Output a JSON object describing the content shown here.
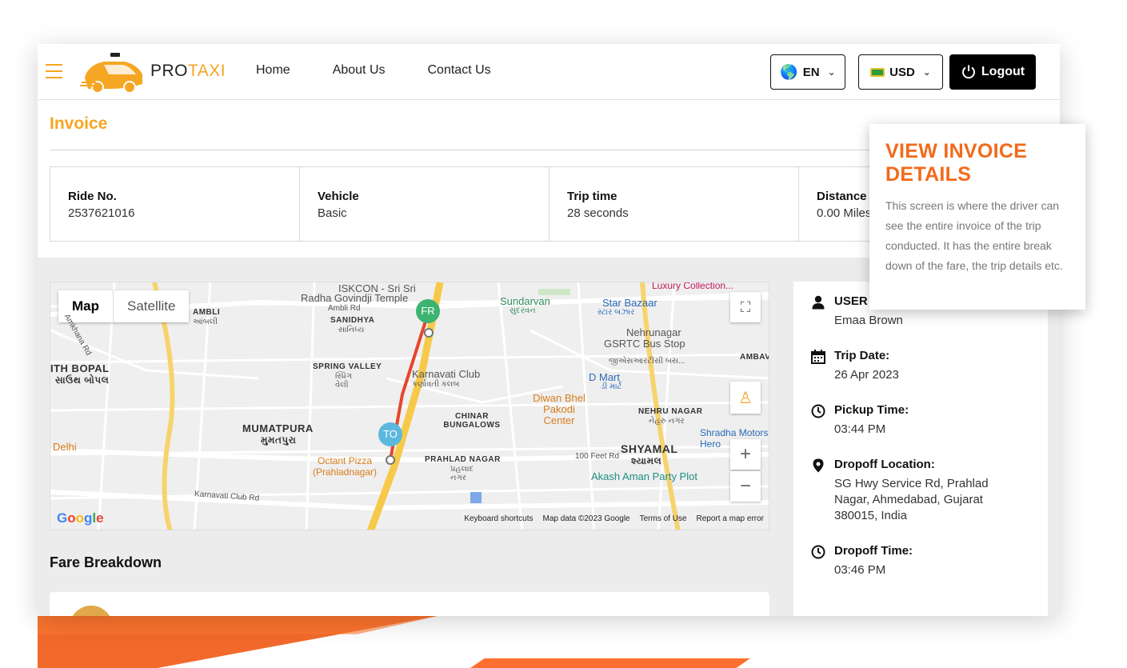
{
  "header": {
    "logo_pro": "PRO",
    "logo_taxi": "TAXI",
    "nav": [
      "Home",
      "About Us",
      "Contact Us"
    ],
    "language": "EN",
    "currency": "USD",
    "logout": "Logout"
  },
  "invoice": {
    "title": "Invoice",
    "stats": [
      {
        "label": "Ride No.",
        "value": "2537621016"
      },
      {
        "label": "Vehicle",
        "value": "Basic"
      },
      {
        "label": "Trip time",
        "value": "28 seconds"
      },
      {
        "label": "Distance",
        "value": "0.00 Miles"
      }
    ]
  },
  "map": {
    "tabs": [
      "Map",
      "Satellite"
    ],
    "pin_from": "FR",
    "pin_to": "TO",
    "labels": {
      "iskcon": "ISKCON - Sri Sri",
      "radha": "Radha Govindji Temple",
      "ambli_rd": "Ambli Rd",
      "ambli": "AMBLI",
      "ambli_gu": "આંબલી",
      "sanidhya": "SANIDHYA",
      "sanidhya_gu": "સાનિધ્ય",
      "sundarvan": "Sundarvan",
      "sundarvan_gu": "સુંદરવન",
      "star_bazaar": "Star Bazaar",
      "star_bazaar_gu": "સ્ટાર બઝાર",
      "luxury": "Luxury Collection...",
      "nehrunagar": "Nehrunagar",
      "gsrtc": "GSRTC Bus Stop",
      "gsrtc_gu": "જીએસઆરટીસી બસ...",
      "ambav": "AMBAV",
      "south_bopal": "ITH BOPAL",
      "south_bopal_gu": "સાઉથ બોપલ",
      "spring_valley": "SPRING VALLEY",
      "spring_valley_gu": "સ્પ્રિંગ વેલી",
      "karnavati": "Karnavati Club",
      "karnavati_gu": "કર્ણાવતી કલબ",
      "dmart": "D Mart",
      "dmart_gu": "ડી માર્ટ",
      "diwan": "Diwan Bhel Pakodi Center",
      "chinar": "CHINAR BUNGALOWS",
      "nehru_nagar": "NEHRU NAGAR",
      "nehru_nagar_gu": "નેહરુ નગર",
      "mumatpura": "MUMATPURA",
      "mumatpura_gu": "મુમતપુરા",
      "shyamal": "SHYAMAL",
      "shyamal_gu": "શ્યામલ",
      "shradha": "Shradha Motors Hero",
      "delhi": "Delhi",
      "octant": "Octant Pizza (Prahladnagar)",
      "prahlad": "PRAHLAD NAGAR",
      "prahlad_gu": "પ્રહલાદ નગર",
      "feet": "100 Feet Rd",
      "akash": "Akash Aman Party Plot",
      "karnavati_rd": "Karnavati Club Rd",
      "khana_rd": "Amkhana Rd"
    },
    "google": "Google",
    "footer": [
      "Keyboard shortcuts",
      "Map data ©2023 Google",
      "Terms of Use",
      "Report a map error"
    ]
  },
  "fare": {
    "title": "Fare Breakdown"
  },
  "side": [
    {
      "label": "USER NAME",
      "value": "Emaa Brown",
      "icon": "user-icon"
    },
    {
      "label": "Trip Date:",
      "value": "26 Apr 2023",
      "icon": "calendar-icon"
    },
    {
      "label": "Pickup Time:",
      "value": "03:44 PM",
      "icon": "clock-icon"
    },
    {
      "label": "Dropoff Location:",
      "value": "SG Hwy Service Rd, Prahlad Nagar, Ahmedabad, Gujarat 380015, India",
      "icon": "location-pin-icon"
    },
    {
      "label": "Dropoff Time:",
      "value": "03:46 PM",
      "icon": "clock-icon"
    }
  ],
  "callout": {
    "title": "VIEW INVOICE DETAILS",
    "body": "This screen is where the driver can see the entire invoice of the trip conducted. It has the entire break down of the fare, the trip details etc."
  },
  "colors": {
    "accent": "#f5a623",
    "callout": "#f26a1b",
    "route": "#e8452b"
  }
}
